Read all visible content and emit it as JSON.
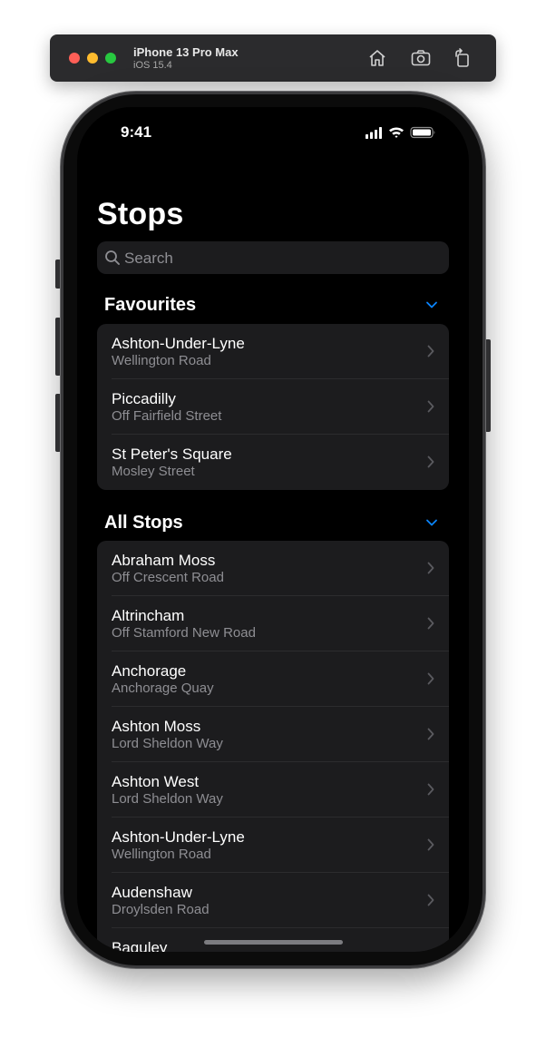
{
  "simulator": {
    "device": "iPhone 13 Pro Max",
    "os": "iOS 15.4",
    "toolbar_icons": [
      "home-icon",
      "screenshot-icon",
      "rotate-icon"
    ]
  },
  "status_bar": {
    "time": "9:41",
    "icons": [
      "cellular-signal-icon",
      "wifi-icon",
      "battery-icon"
    ]
  },
  "page": {
    "title": "Stops",
    "search_placeholder": "Search"
  },
  "sections": {
    "favourites": {
      "title": "Favourites",
      "items": [
        {
          "name": "Ashton-Under-Lyne",
          "sub": "Wellington Road"
        },
        {
          "name": "Piccadilly",
          "sub": "Off Fairfield Street"
        },
        {
          "name": "St Peter's Square",
          "sub": "Mosley Street"
        }
      ]
    },
    "all_stops": {
      "title": "All Stops",
      "items": [
        {
          "name": "Abraham Moss",
          "sub": "Off Crescent Road"
        },
        {
          "name": "Altrincham",
          "sub": "Off Stamford New Road"
        },
        {
          "name": "Anchorage",
          "sub": "Anchorage Quay"
        },
        {
          "name": "Ashton Moss",
          "sub": "Lord Sheldon Way"
        },
        {
          "name": "Ashton West",
          "sub": "Lord Sheldon Way"
        },
        {
          "name": "Ashton-Under-Lyne",
          "sub": "Wellington Road"
        },
        {
          "name": "Audenshaw",
          "sub": "Droylsden Road"
        },
        {
          "name": "Baguley",
          "sub": ""
        }
      ]
    }
  },
  "colors": {
    "accent": "#0a84ff",
    "background": "#000000",
    "cell": "#1c1c1e",
    "secondary_text": "#8e8e93"
  }
}
